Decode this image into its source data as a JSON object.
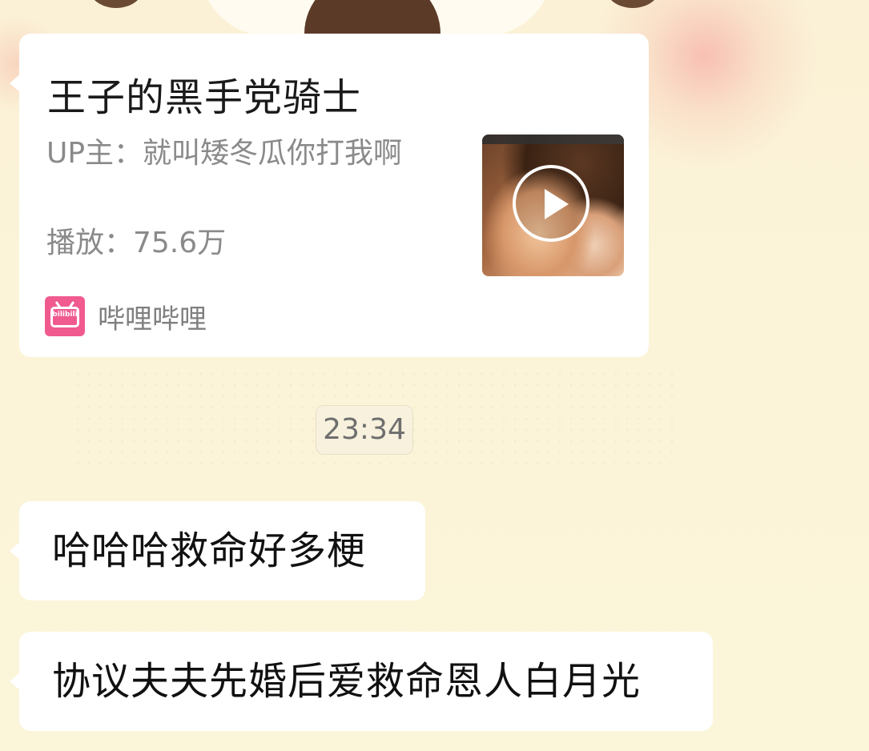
{
  "card": {
    "title": "王子的黑手党骑士",
    "uploader": "UP主：就叫矮冬瓜你打我啊",
    "plays": "播放：75.6万",
    "source_name": "哔哩哔哩",
    "source_icon_text": "bilibili",
    "thumbnail_icon": "play-icon"
  },
  "timestamp": "23:34",
  "messages": [
    {
      "text": "哈哈哈救命好多梗"
    },
    {
      "text": "协议夫夫先婚后爱救命恩人白月光"
    }
  ],
  "colors": {
    "background": "#fbf4d6",
    "bubble": "#ffffff",
    "secondary_text": "#8a8a8a",
    "bilibili_pink": "#f05a8f"
  }
}
